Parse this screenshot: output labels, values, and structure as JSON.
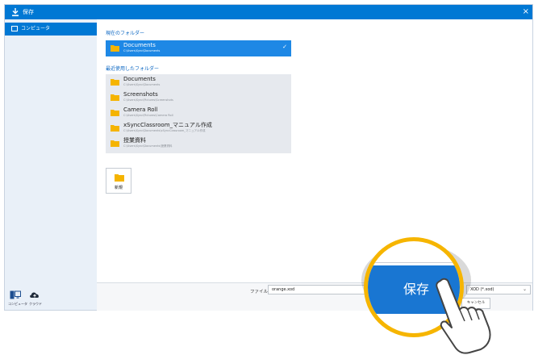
{
  "window": {
    "title": "保存",
    "close_glyph": "×",
    "titlebar_color": "#0078d4"
  },
  "sidebar": {
    "items": [
      {
        "label": "コンピュータ",
        "icon": "computer-icon",
        "selected": true
      }
    ],
    "bottom_items": [
      {
        "label": "コンピュータ",
        "icon": "computer-icon"
      },
      {
        "label": "クラウド",
        "icon": "cloud-icon"
      }
    ]
  },
  "current_folder": {
    "heading": "現在のフォルダー",
    "name": "Documents",
    "path": "C:\\Users\\Sync\\Documents",
    "check_glyph": "✓"
  },
  "recent_folders": {
    "heading": "最近使用したフォルダー",
    "items": [
      {
        "name": "Documents",
        "path": "C:\\Users\\Sync\\Documents"
      },
      {
        "name": "Screenshots",
        "path": "C:\\Users\\Sync\\Pictures\\Screenshots"
      },
      {
        "name": "Camera Roll",
        "path": "C:\\Users\\Sync\\Pictures\\Camera Roll"
      },
      {
        "name": "xSyncClassroom_マニュアル作成",
        "path": "C:\\Users\\Sync\\Documents\\xSyncClassroom_マニュアル作成"
      },
      {
        "name": "授業資料",
        "path": "C:\\Users\\Sync\\Documents\\授業資料"
      }
    ]
  },
  "new_folder": {
    "label": "新規"
  },
  "footer": {
    "filename_label": "ファイル名",
    "filename_value": "orange.xod",
    "filetype_value": "XOD (*.xod)",
    "save_label": "保存",
    "cancel_label": "キャンセル"
  },
  "colors": {
    "accent": "#0078d4",
    "folder": "#f5b400",
    "highlight_ring": "#f6b500",
    "save_button": "#1976d2"
  }
}
